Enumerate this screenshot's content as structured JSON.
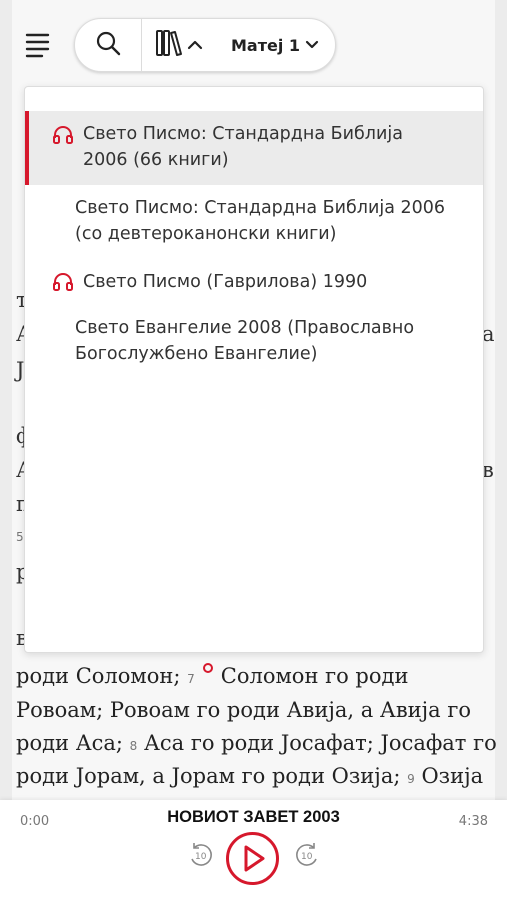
{
  "toolbar": {
    "search_icon": "search-icon",
    "version_icon": "book-shelf-icon",
    "book_label": "Матеј 1"
  },
  "versions_menu": {
    "items": [
      {
        "label_line1": "Свето Писмо: Стандардна Библија",
        "label_line2": "2006 (66 книги)",
        "audio": true,
        "selected": true
      },
      {
        "label_line1": "Свето Писмо: Стандардна Библија 2006",
        "label_line2": "(со девтероканонски книги)",
        "audio": false,
        "selected": false
      },
      {
        "label_line1": "Свето Писмо (Гаврилова) 1990",
        "label_line2": "",
        "audio": true,
        "selected": false
      },
      {
        "label_line1": "Свето Евангелие 2008 (Православно",
        "label_line2": "Богослужбено Евангелие)",
        "audio": false,
        "selected": false
      }
    ]
  },
  "background_text": {
    "visible_fragments": [
      "т",
      "А",
      "а",
      "Ј",
      "ф",
      "А",
      "в",
      "п",
      "5",
      "р",
      "в"
    ],
    "line1_a": "роди Соломон;",
    "line1_vnum": "7",
    "line1_b": "Соломон го роди",
    "line2": "Ровоам; Ровоам го роди Авија, а Авија го",
    "line3_a": "роди Аса;",
    "line3_vnum": "8",
    "line3_b": "Аса го роди Јосафат; Јосафат го",
    "line4_a": "роди Јорам, а Јорам го роди Озија;",
    "line4_vnum": "9",
    "line4_b": "Озија"
  },
  "player": {
    "title": "НОВИОТ ЗАВЕТ 2003",
    "elapsed": "0:00",
    "duration": "4:38",
    "skip_back_label": "10",
    "skip_forward_label": "10"
  },
  "colors": {
    "accent": "#d6182c",
    "selected_bg": "#ebebeb"
  }
}
